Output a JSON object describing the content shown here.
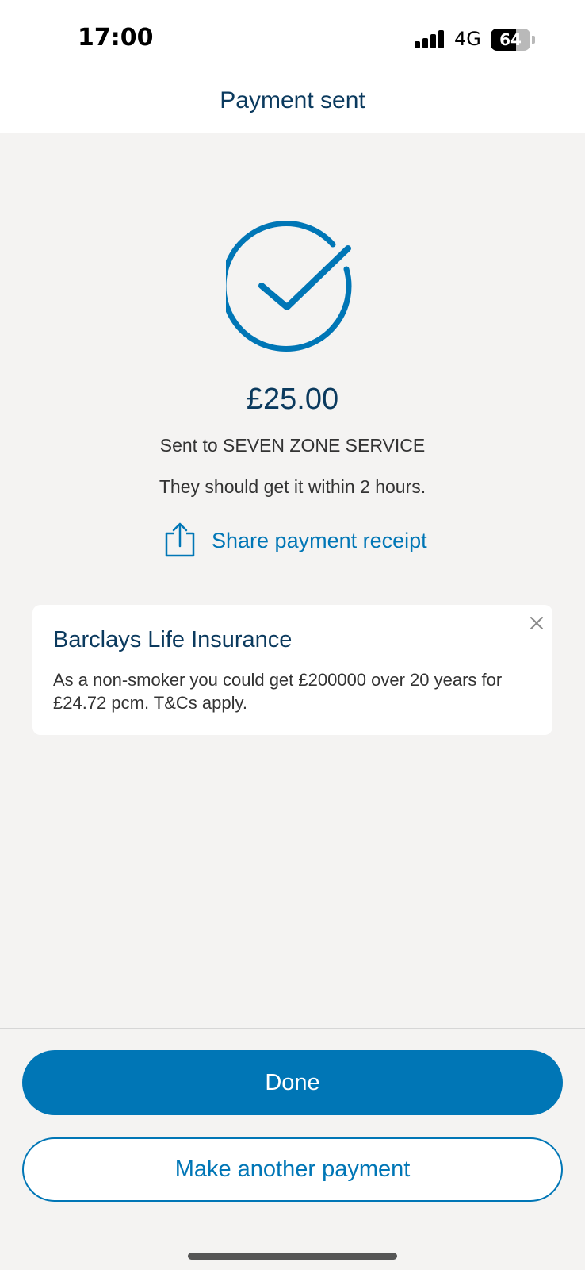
{
  "status_bar": {
    "time": "17:00",
    "network": "4G",
    "battery_percent": 64,
    "battery_label": "64",
    "signal_icon": "cellular-signal-icon",
    "battery_icon": "battery-icon"
  },
  "header": {
    "title": "Payment sent"
  },
  "confirmation": {
    "icon": "check-circle-icon",
    "amount": "£25.00",
    "recipient_text": "Sent to SEVEN ZONE SERVICE",
    "eta_text": "They should get it within 2 hours.",
    "share_icon": "share-icon",
    "share_label": "Share payment receipt"
  },
  "promo": {
    "title": "Barclays Life Insurance",
    "body": "As a non-smoker you could get £200000 over 20 years for £24.72 pcm. T&Cs apply.",
    "close_icon": "close-icon"
  },
  "actions": {
    "done_label": "Done",
    "another_label": "Make another payment"
  },
  "colors": {
    "accent": "#0076b6",
    "heading": "#0b3a5e",
    "background": "#f4f3f2",
    "card": "#ffffff"
  }
}
